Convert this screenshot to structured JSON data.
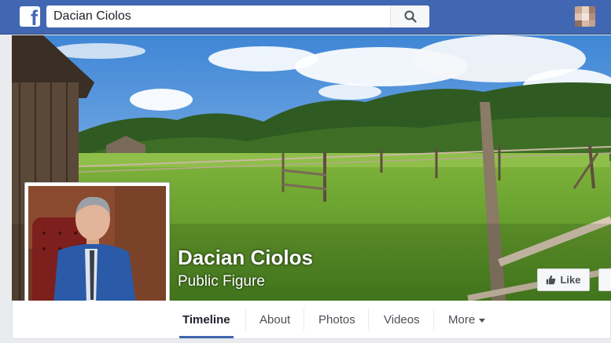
{
  "search": {
    "value": "Dacian Ciolos"
  },
  "page": {
    "name": "Dacian Ciolos",
    "category": "Public Figure"
  },
  "actions": {
    "like_label": "Like"
  },
  "tabs": [
    {
      "label": "Timeline",
      "active": true
    },
    {
      "label": "About"
    },
    {
      "label": "Photos"
    },
    {
      "label": "Videos"
    },
    {
      "label": "More"
    }
  ],
  "colors": {
    "brand": "#4267b2",
    "sky": "#7fb6e6",
    "meadow": "#5f9a2a"
  },
  "icons": [
    "facebook-logo-icon",
    "search-icon",
    "thumbs-up-icon",
    "chevron-down-icon"
  ]
}
